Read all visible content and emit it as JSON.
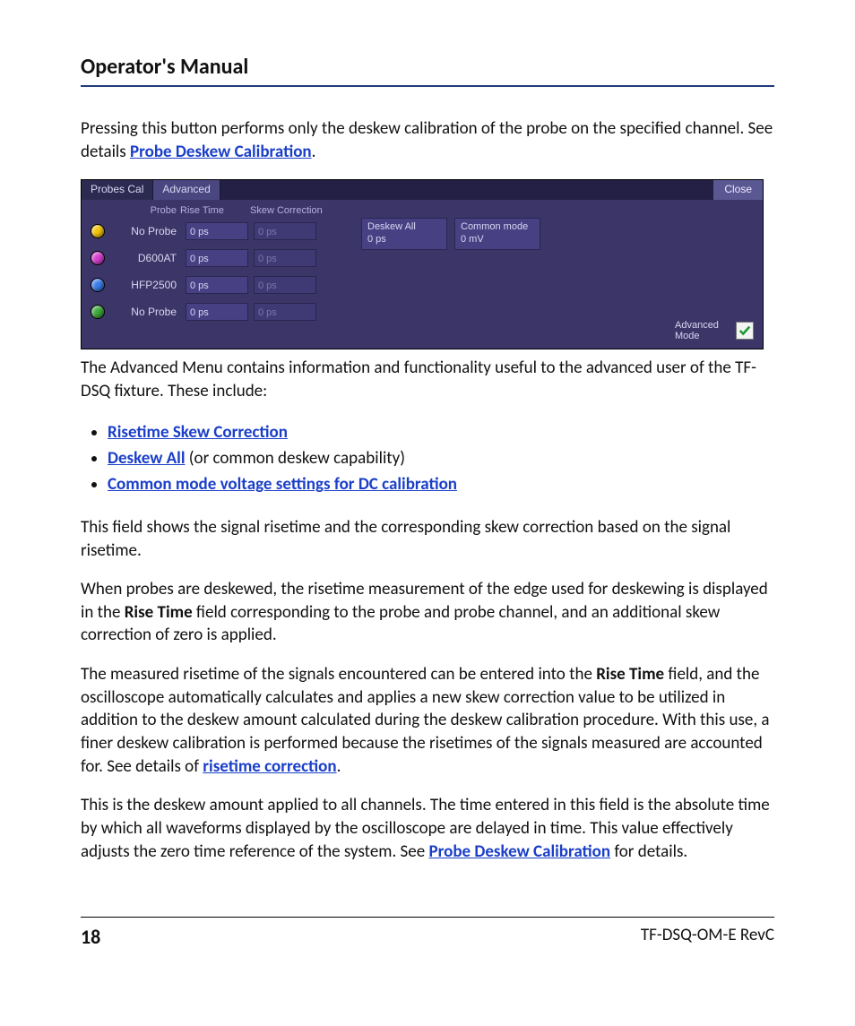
{
  "doc": {
    "title": "Operator's Manual",
    "page_number": "18",
    "doc_id": "TF-DSQ-OM-E RevC"
  },
  "body": {
    "p1_a": "Pressing this button performs only the deskew calibration of the probe on the specified channel. See details ",
    "p1_link": "Probe Deskew Calibration",
    "p1_b": ".",
    "p2": "The Advanced Menu contains information and functionality useful to the advanced user of the TF-DSQ fixture. These include:",
    "bullets": {
      "b1_link": "Risetime Skew Correction",
      "b2_link": "Deskew All",
      "b2_rest": " (or common deskew capability)",
      "b3_link": "Common mode voltage settings for DC calibration"
    },
    "p3": "This field shows the signal risetime and the corresponding skew correction based on the signal risetime.",
    "p4_a": "When probes are deskewed, the risetime measurement of the edge used for deskewing is displayed in the ",
    "p4_b": "Rise Time",
    "p4_c": " field corresponding to the probe and probe channel, and an additional skew correction of zero is applied.",
    "p5_a": "The measured risetime of the signals encountered can be entered into the ",
    "p5_b": "Rise Time",
    "p5_c": " field, and the oscilloscope automatically calculates and applies a new skew correction value to be utilized in addition to the deskew amount calculated during the deskew calibration procedure. With this use, a finer deskew calibration is performed because the risetimes of the signals measured are accounted for. See details of ",
    "p5_link": "risetime correction",
    "p5_d": ".",
    "p6_a": "This is the deskew amount applied to all channels. The time entered in this field is the absolute time by which all waveforms displayed by the oscilloscope are delayed in time. This value effectively adjusts the zero time reference of the system. See ",
    "p6_link": "Probe Deskew Calibration",
    "p6_b": " for details."
  },
  "panel": {
    "tabs": {
      "probes_cal": "Probes Cal",
      "advanced": "Advanced"
    },
    "close": "Close",
    "headers": {
      "probe": "Probe",
      "rise_time": "Rise Time",
      "skew_corr": "Skew Correction"
    },
    "rows": [
      {
        "probe": "No Probe",
        "rise": "0 ps",
        "skew": "0 ps"
      },
      {
        "probe": "D600AT",
        "rise": "0 ps",
        "skew": "0 ps"
      },
      {
        "probe": "HFP2500",
        "rise": "0 ps",
        "skew": "0 ps"
      },
      {
        "probe": "No Probe",
        "rise": "0 ps",
        "skew": "0 ps"
      }
    ],
    "deskew_all": {
      "label": "Deskew All",
      "value": "0 ps"
    },
    "common_mode": {
      "label": "Common mode",
      "value": "0 mV"
    },
    "adv_mode": {
      "label": "Advanced Mode",
      "checked": true
    }
  }
}
